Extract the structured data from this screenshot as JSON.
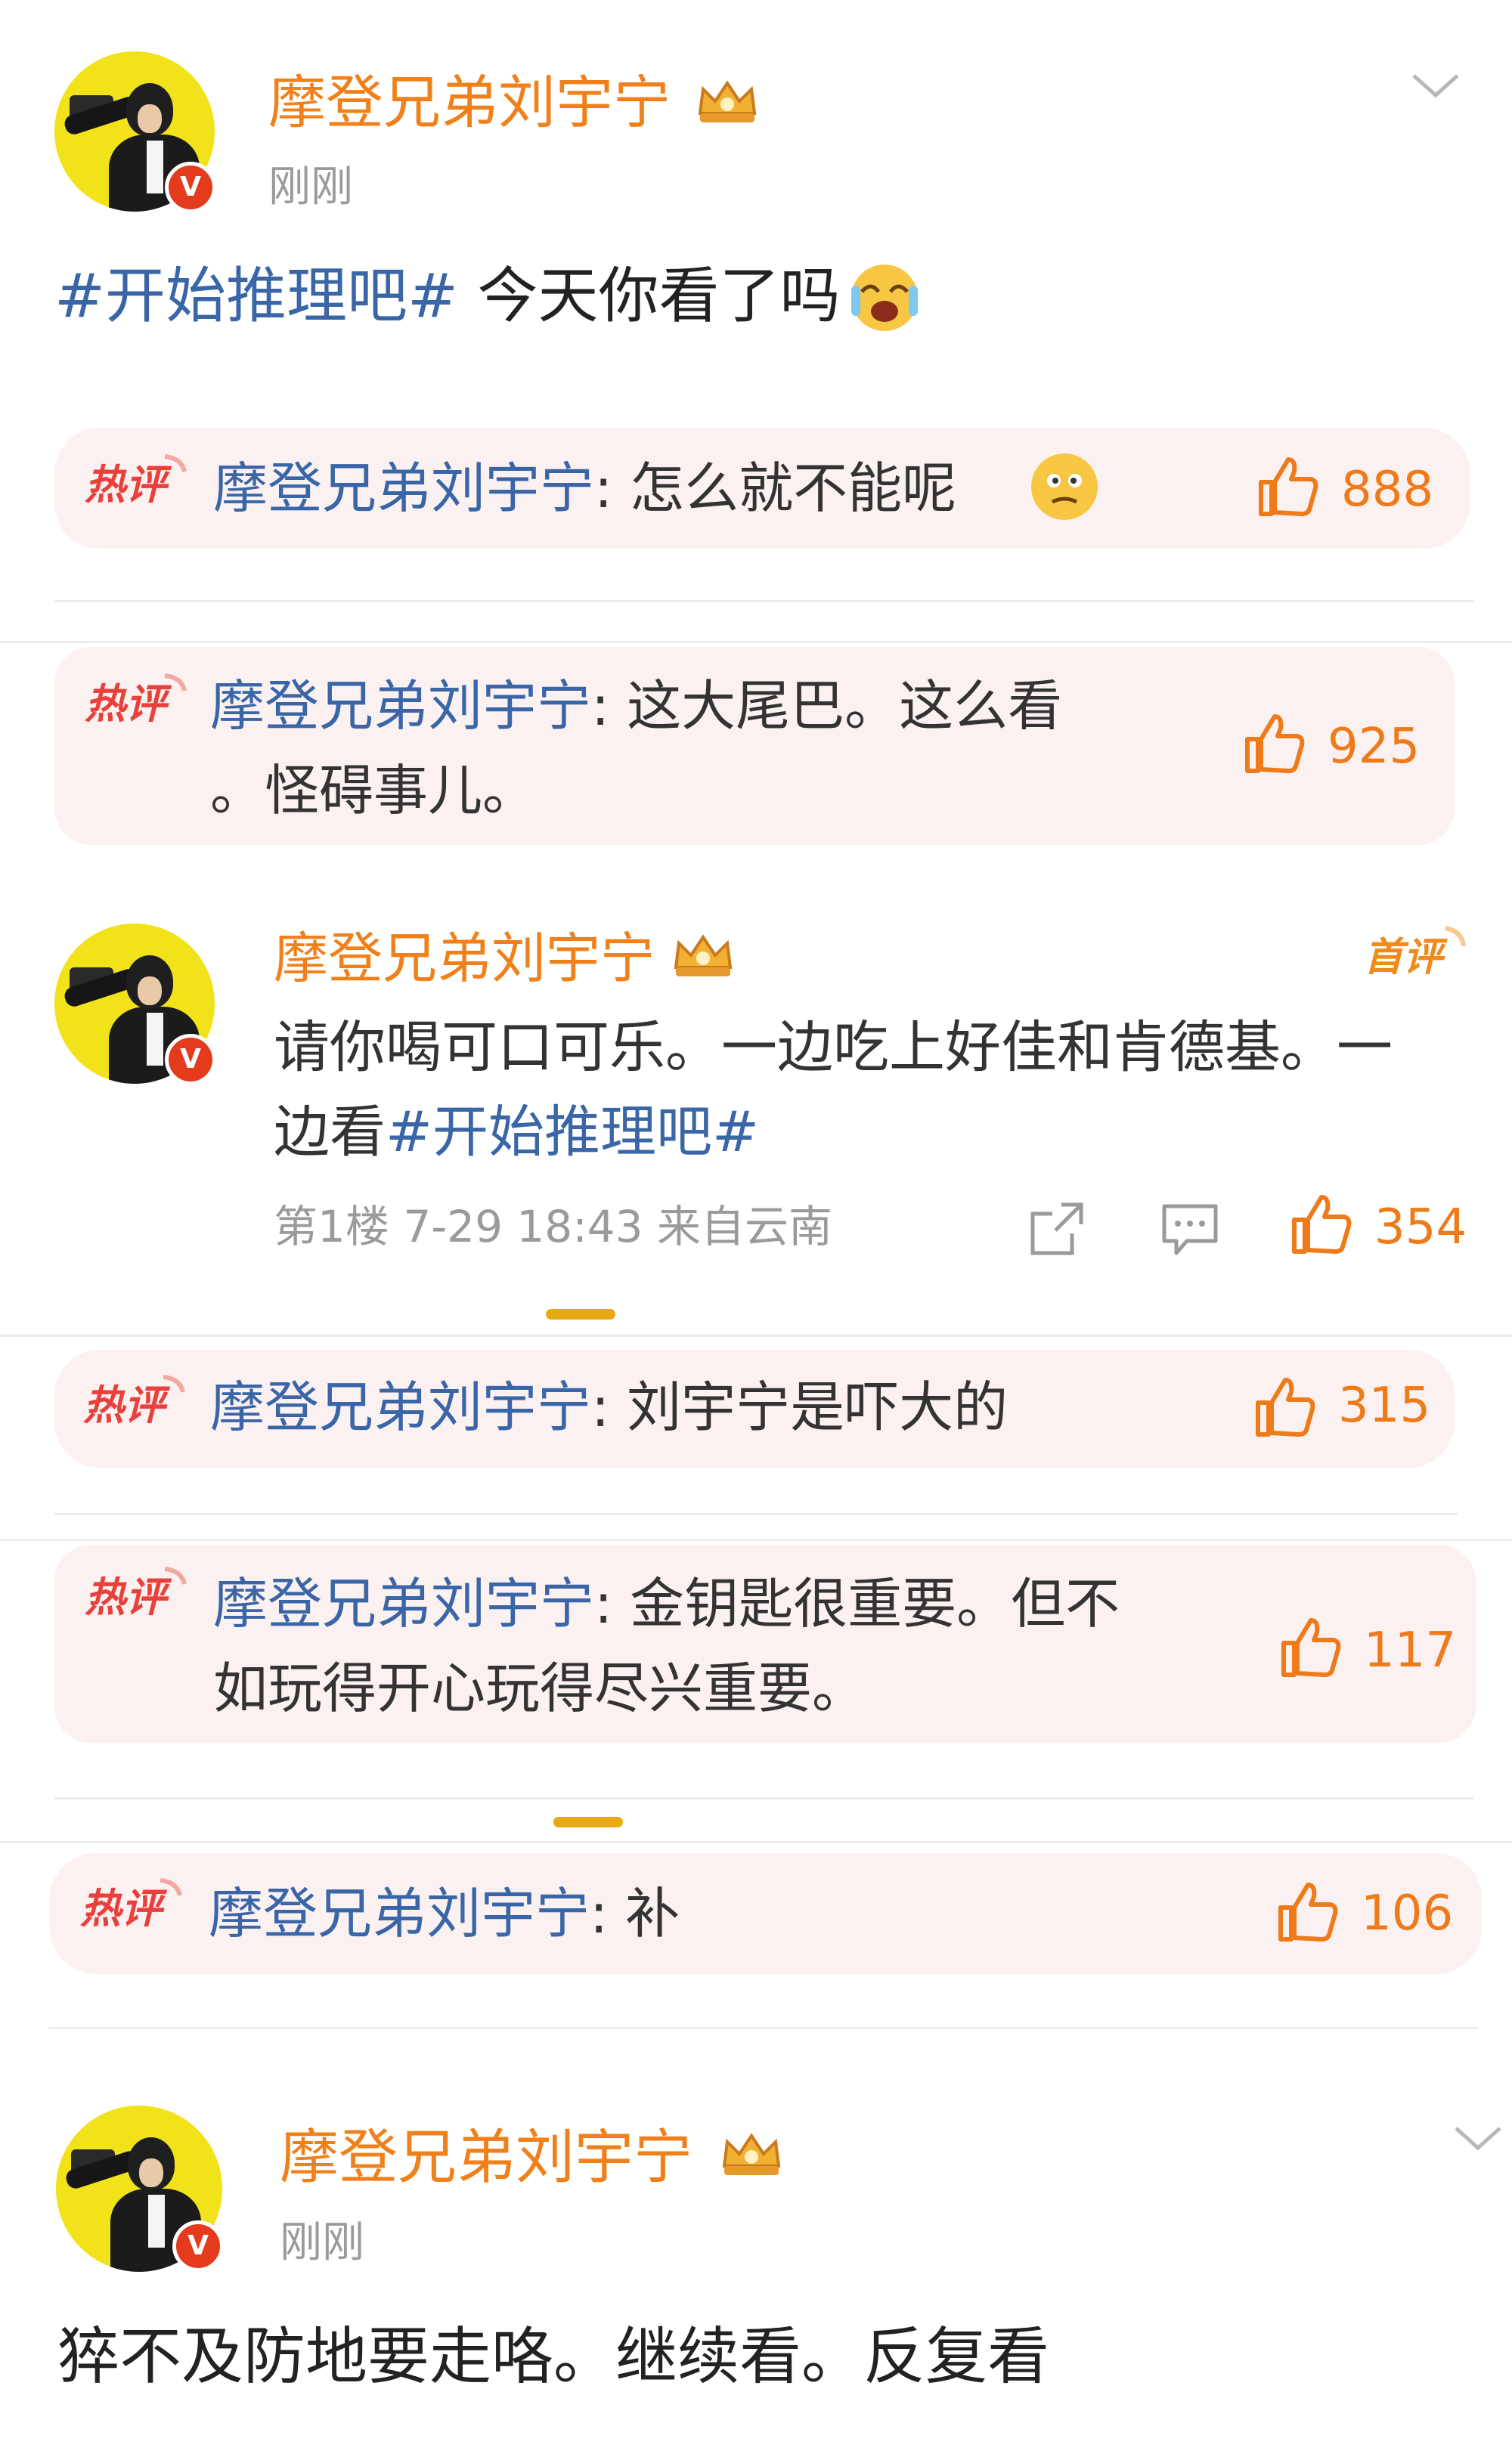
{
  "post1": {
    "username": "摩登兄弟刘宇宁",
    "time": "刚刚",
    "topic": "#开始推理吧#",
    "text": " 今天你看了吗"
  },
  "hot_label": "热评",
  "first_label": "首评",
  "comments": [
    {
      "name": "摩登兄弟刘宇宁",
      "line1": ": 怎么就不能呢",
      "line2": "",
      "likes": "888"
    },
    {
      "name": "摩登兄弟刘宇宁",
      "line1": ": 这大尾巴。这么看",
      "line2": "。怪碍事儿。",
      "likes": "925"
    },
    {
      "name": "摩登兄弟刘宇宁",
      "line1": ": 刘宇宁是吓大的",
      "line2": "",
      "likes": "315"
    },
    {
      "name": "摩登兄弟刘宇宁",
      "line1": ": 金钥匙很重要。但不",
      "line2": "如玩得开心玩得尽兴重要。",
      "likes": "117"
    },
    {
      "name": "摩登兄弟刘宇宁",
      "line1": ": 补",
      "line2": "",
      "likes": "106"
    }
  ],
  "reply": {
    "username": "摩登兄弟刘宇宁",
    "line1": "请你喝可口可乐。一边吃上好佳和肯德基。一",
    "line2_prefix": "边看",
    "line2_topic": "#开始推理吧#",
    "meta": "第1楼  7-29 18:43  来自云南",
    "likes": "354"
  },
  "post2": {
    "username": "摩登兄弟刘宇宁",
    "time": "刚刚",
    "text": "猝不及防地要走咯。继续看。反复看"
  },
  "colors": {
    "username": "#f0801a",
    "link": "#3a66a8",
    "hot": "#e8403a",
    "like": "#ee7a1a",
    "pager": "#e7a812"
  },
  "icons": [
    "chevron-down-icon",
    "crown-icon",
    "verified-badge-icon",
    "hot-comment-icon",
    "thumb-up-icon",
    "share-icon",
    "comment-icon",
    "emoji-icon"
  ]
}
